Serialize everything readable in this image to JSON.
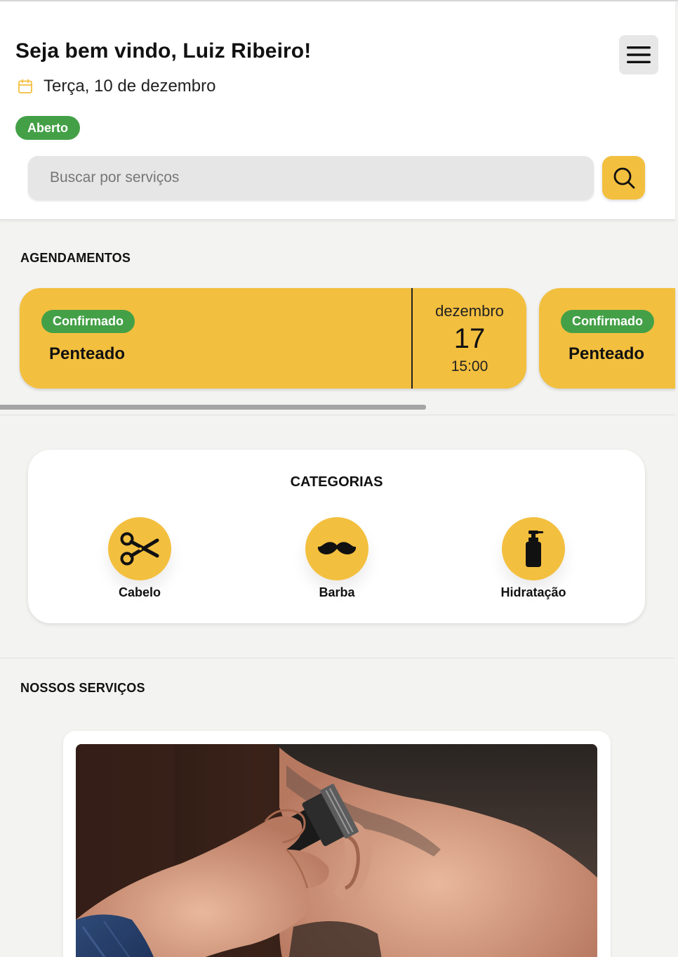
{
  "header": {
    "greeting": "Seja bem vindo, Luiz Ribeiro!",
    "date": "Terça, 10 de dezembro",
    "status": "Aberto",
    "status_color": "#44a047"
  },
  "search": {
    "placeholder": "Buscar por serviços",
    "value": ""
  },
  "appointments": {
    "title": "AGENDAMENTOS",
    "items": [
      {
        "status": "Confirmado",
        "service": "Penteado",
        "month": "dezembro",
        "day": "17",
        "time": "15:00"
      },
      {
        "status": "Confirmado",
        "service": "Penteado"
      }
    ]
  },
  "categories": {
    "title": "CATEGORIAS",
    "items": [
      {
        "label": "Cabelo",
        "icon": "scissors-icon"
      },
      {
        "label": "Barba",
        "icon": "mustache-icon"
      },
      {
        "label": "Hidratação",
        "icon": "lotion-bottle-icon"
      }
    ]
  },
  "services": {
    "title": "NOSSOS SERVIÇOS"
  },
  "colors": {
    "accent": "#f3bf3f",
    "confirmed": "#44a047",
    "background": "#f3f3f1"
  }
}
